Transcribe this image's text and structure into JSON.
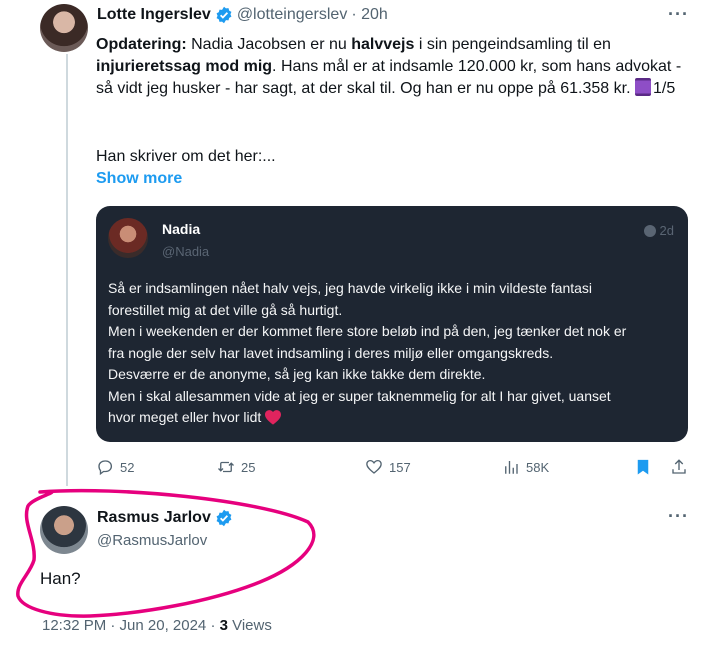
{
  "tweet": {
    "author_name": "Lotte Ingerslev",
    "author_handle": "@lotteingerslev",
    "time": "· 20h",
    "more_label": "···",
    "text": {
      "p1": "Opdatering:",
      "p2": " Nadia Jacobsen er nu ",
      "p3": "halvvejs",
      "p4": " i sin pengeindsamling til en ",
      "p5": "injurieretssag mod mig",
      "p6": ". Hans mål er at indsamle 120.000 kr, som hans advokat - så vidt jeg husker - har sagt, at der skal til. Og han er nu oppe på 61.358 kr. ",
      "p7": "1/5",
      "p8": "Han skriver om det her:..."
    },
    "show_more": "Show more",
    "quoted": {
      "name": "Nadia",
      "handle": "@Nadia",
      "time": "2d",
      "lines": [
        "Så er indsamlingen nået halv vejs, jeg havde virkelig ikke i min vildeste fantasi",
        "forestillet mig at det ville gå så hurtigt.",
        "Men i weekenden er der kommet flere store beløb ind på den, jeg tænker det nok er",
        "fra nogle der selv har lavet indsamling i deres miljø eller omgangskreds.",
        "Desværre er de anonyme, så jeg kan ikke takke dem direkte.",
        "Men i skal allesammen vide at jeg er super taknemmelig for alt I har givet, uanset",
        "hvor meget eller hvor lidt"
      ]
    },
    "actions": {
      "replies": "52",
      "retweets": "25",
      "likes": "157",
      "views": "58K"
    }
  },
  "reply": {
    "author_name": "Rasmus Jarlov",
    "author_handle": "@RasmusJarlov",
    "more_label": "···",
    "text": "Han?",
    "timestamp": "12:32 PM · Jun 20, 2024 · ",
    "views_count": "3",
    "views_label": " Views"
  },
  "colors": {
    "accent": "#1d9bf0",
    "annotation_circle": "#e6007e",
    "like_heart": "#e0245e"
  }
}
